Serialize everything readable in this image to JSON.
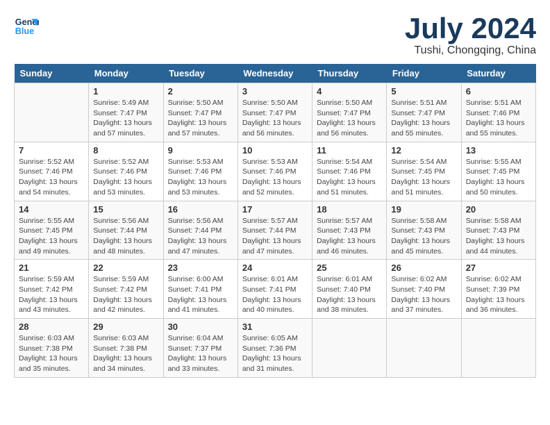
{
  "header": {
    "logo_line1": "General",
    "logo_line2": "Blue",
    "month": "July 2024",
    "location": "Tushi, Chongqing, China"
  },
  "days_of_week": [
    "Sunday",
    "Monday",
    "Tuesday",
    "Wednesday",
    "Thursday",
    "Friday",
    "Saturday"
  ],
  "weeks": [
    [
      {
        "day": "",
        "info": ""
      },
      {
        "day": "1",
        "info": "Sunrise: 5:49 AM\nSunset: 7:47 PM\nDaylight: 13 hours\nand 57 minutes."
      },
      {
        "day": "2",
        "info": "Sunrise: 5:50 AM\nSunset: 7:47 PM\nDaylight: 13 hours\nand 57 minutes."
      },
      {
        "day": "3",
        "info": "Sunrise: 5:50 AM\nSunset: 7:47 PM\nDaylight: 13 hours\nand 56 minutes."
      },
      {
        "day": "4",
        "info": "Sunrise: 5:50 AM\nSunset: 7:47 PM\nDaylight: 13 hours\nand 56 minutes."
      },
      {
        "day": "5",
        "info": "Sunrise: 5:51 AM\nSunset: 7:47 PM\nDaylight: 13 hours\nand 55 minutes."
      },
      {
        "day": "6",
        "info": "Sunrise: 5:51 AM\nSunset: 7:46 PM\nDaylight: 13 hours\nand 55 minutes."
      }
    ],
    [
      {
        "day": "7",
        "info": "Sunrise: 5:52 AM\nSunset: 7:46 PM\nDaylight: 13 hours\nand 54 minutes."
      },
      {
        "day": "8",
        "info": "Sunrise: 5:52 AM\nSunset: 7:46 PM\nDaylight: 13 hours\nand 53 minutes."
      },
      {
        "day": "9",
        "info": "Sunrise: 5:53 AM\nSunset: 7:46 PM\nDaylight: 13 hours\nand 53 minutes."
      },
      {
        "day": "10",
        "info": "Sunrise: 5:53 AM\nSunset: 7:46 PM\nDaylight: 13 hours\nand 52 minutes."
      },
      {
        "day": "11",
        "info": "Sunrise: 5:54 AM\nSunset: 7:46 PM\nDaylight: 13 hours\nand 51 minutes."
      },
      {
        "day": "12",
        "info": "Sunrise: 5:54 AM\nSunset: 7:45 PM\nDaylight: 13 hours\nand 51 minutes."
      },
      {
        "day": "13",
        "info": "Sunrise: 5:55 AM\nSunset: 7:45 PM\nDaylight: 13 hours\nand 50 minutes."
      }
    ],
    [
      {
        "day": "14",
        "info": "Sunrise: 5:55 AM\nSunset: 7:45 PM\nDaylight: 13 hours\nand 49 minutes."
      },
      {
        "day": "15",
        "info": "Sunrise: 5:56 AM\nSunset: 7:44 PM\nDaylight: 13 hours\nand 48 minutes."
      },
      {
        "day": "16",
        "info": "Sunrise: 5:56 AM\nSunset: 7:44 PM\nDaylight: 13 hours\nand 47 minutes."
      },
      {
        "day": "17",
        "info": "Sunrise: 5:57 AM\nSunset: 7:44 PM\nDaylight: 13 hours\nand 47 minutes."
      },
      {
        "day": "18",
        "info": "Sunrise: 5:57 AM\nSunset: 7:43 PM\nDaylight: 13 hours\nand 46 minutes."
      },
      {
        "day": "19",
        "info": "Sunrise: 5:58 AM\nSunset: 7:43 PM\nDaylight: 13 hours\nand 45 minutes."
      },
      {
        "day": "20",
        "info": "Sunrise: 5:58 AM\nSunset: 7:43 PM\nDaylight: 13 hours\nand 44 minutes."
      }
    ],
    [
      {
        "day": "21",
        "info": "Sunrise: 5:59 AM\nSunset: 7:42 PM\nDaylight: 13 hours\nand 43 minutes."
      },
      {
        "day": "22",
        "info": "Sunrise: 5:59 AM\nSunset: 7:42 PM\nDaylight: 13 hours\nand 42 minutes."
      },
      {
        "day": "23",
        "info": "Sunrise: 6:00 AM\nSunset: 7:41 PM\nDaylight: 13 hours\nand 41 minutes."
      },
      {
        "day": "24",
        "info": "Sunrise: 6:01 AM\nSunset: 7:41 PM\nDaylight: 13 hours\nand 40 minutes."
      },
      {
        "day": "25",
        "info": "Sunrise: 6:01 AM\nSunset: 7:40 PM\nDaylight: 13 hours\nand 38 minutes."
      },
      {
        "day": "26",
        "info": "Sunrise: 6:02 AM\nSunset: 7:40 PM\nDaylight: 13 hours\nand 37 minutes."
      },
      {
        "day": "27",
        "info": "Sunrise: 6:02 AM\nSunset: 7:39 PM\nDaylight: 13 hours\nand 36 minutes."
      }
    ],
    [
      {
        "day": "28",
        "info": "Sunrise: 6:03 AM\nSunset: 7:38 PM\nDaylight: 13 hours\nand 35 minutes."
      },
      {
        "day": "29",
        "info": "Sunrise: 6:03 AM\nSunset: 7:38 PM\nDaylight: 13 hours\nand 34 minutes."
      },
      {
        "day": "30",
        "info": "Sunrise: 6:04 AM\nSunset: 7:37 PM\nDaylight: 13 hours\nand 33 minutes."
      },
      {
        "day": "31",
        "info": "Sunrise: 6:05 AM\nSunset: 7:36 PM\nDaylight: 13 hours\nand 31 minutes."
      },
      {
        "day": "",
        "info": ""
      },
      {
        "day": "",
        "info": ""
      },
      {
        "day": "",
        "info": ""
      }
    ]
  ]
}
